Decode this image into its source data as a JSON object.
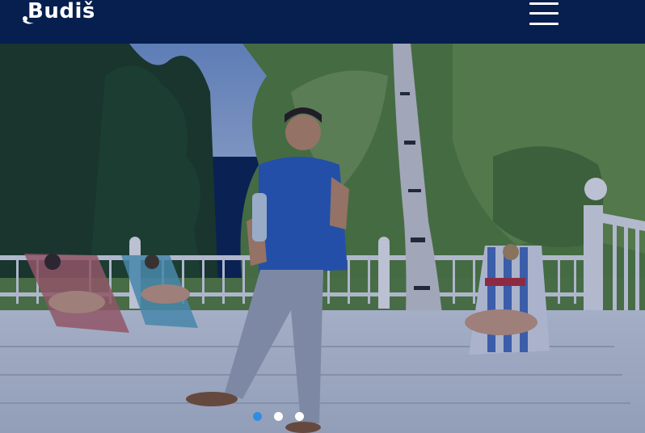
{
  "header": {
    "logo_text": "Budiš",
    "menu_icon": "hamburger-menu-icon",
    "background": "#061f4f"
  },
  "hero": {
    "image": "man-with-water-bottle-on-sun-deck",
    "overlay_color": "#0c1e5f"
  },
  "carousel": {
    "slides": 3,
    "active_index": 0,
    "active_color": "#2f8ee0",
    "inactive_color": "#ffffff"
  }
}
